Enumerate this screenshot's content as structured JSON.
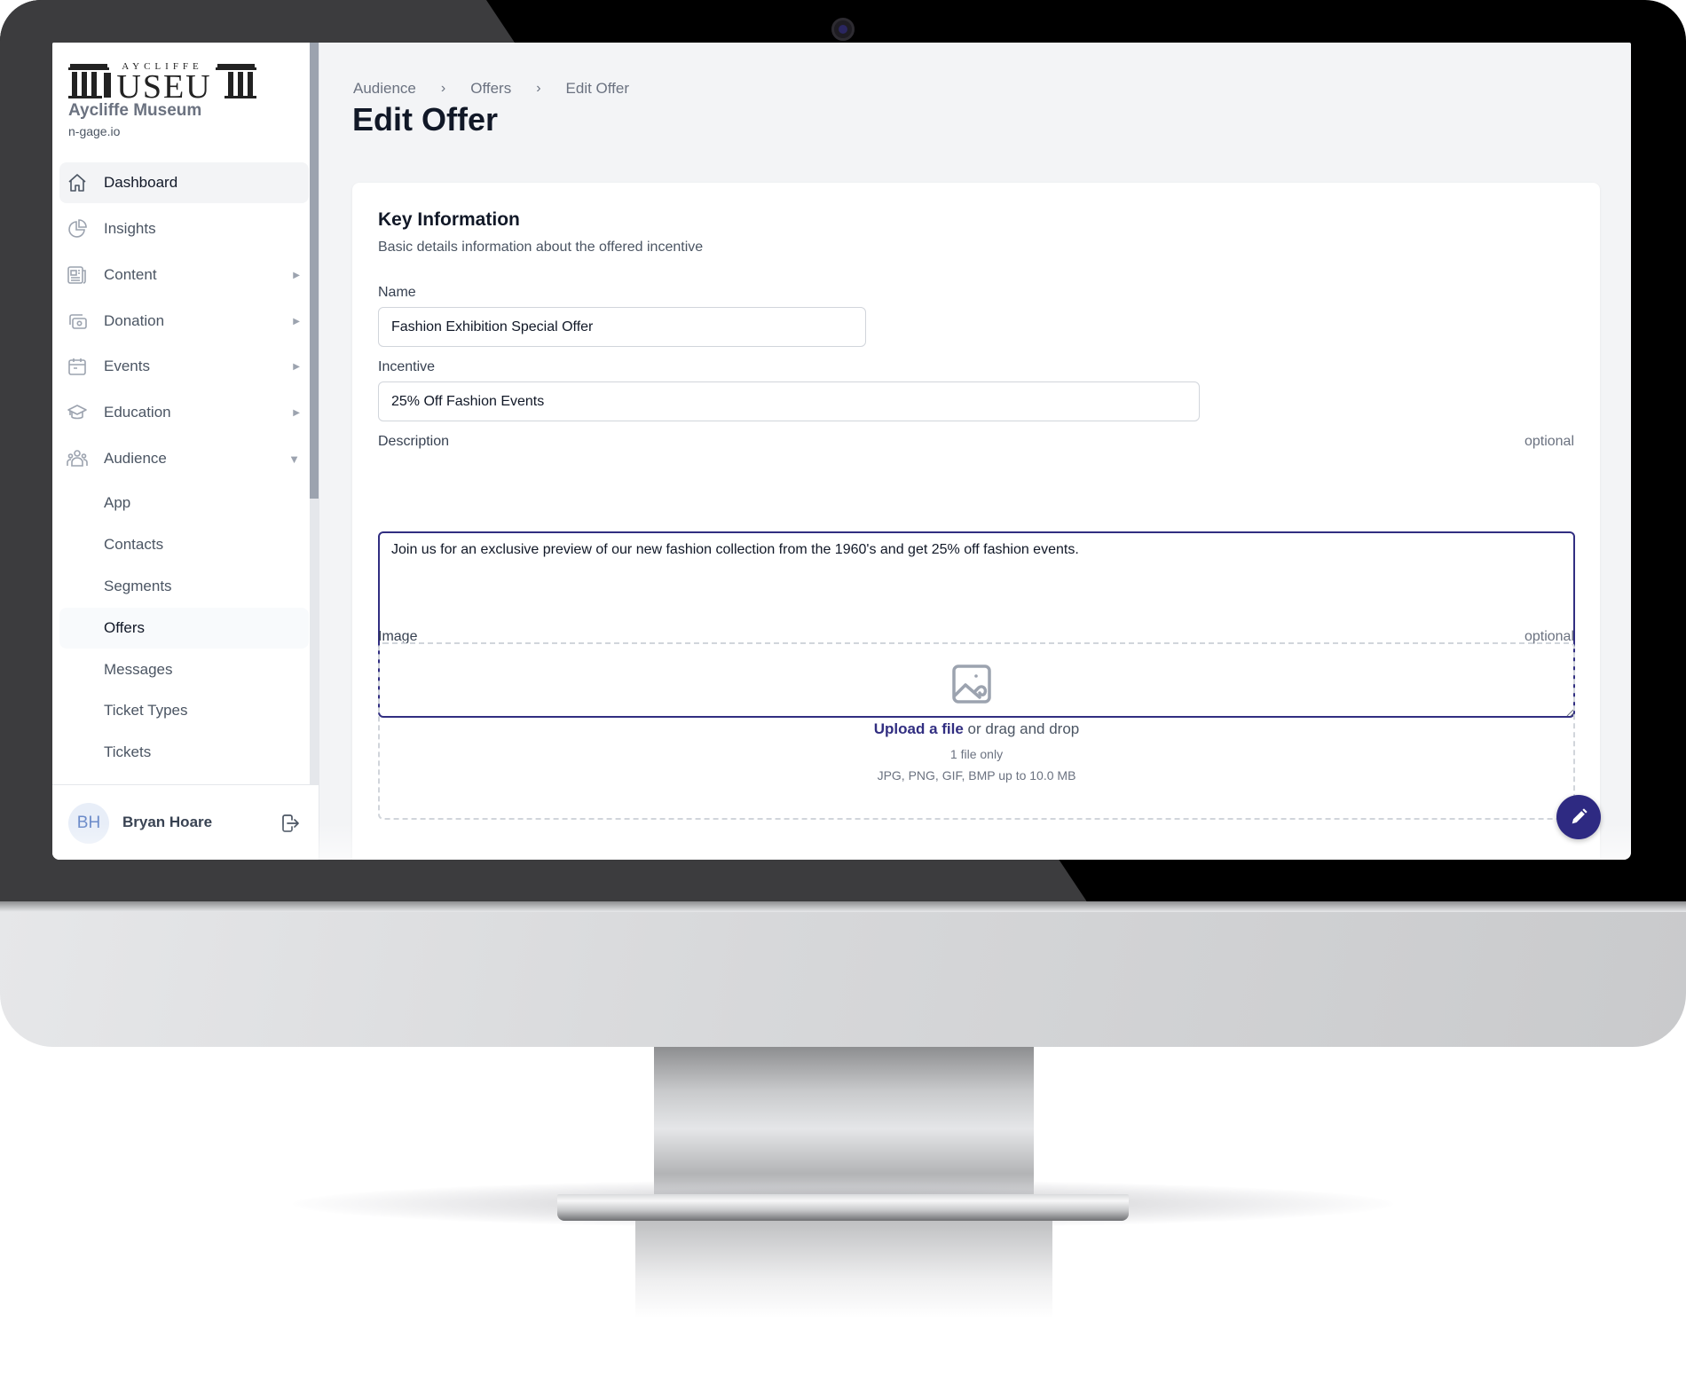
{
  "org": {
    "logo_text_top": "AYCLIFFE",
    "logo_text_main": "MUSEUM",
    "name": "Aycliffe Museum",
    "domain": "n-gage.io"
  },
  "sidebar": {
    "items": [
      {
        "label": "Dashboard",
        "icon": "home-icon",
        "state": "active"
      },
      {
        "label": "Insights",
        "icon": "pie-chart-icon"
      },
      {
        "label": "Content",
        "icon": "newspaper-icon",
        "expandable": true
      },
      {
        "label": "Donation",
        "icon": "cash-icon",
        "expandable": true
      },
      {
        "label": "Events",
        "icon": "calendar-icon",
        "expandable": true
      },
      {
        "label": "Education",
        "icon": "academic-cap-icon",
        "expandable": true
      },
      {
        "label": "Audience",
        "icon": "user-group-icon",
        "expandable": true,
        "expanded": true
      }
    ],
    "audience_children": [
      {
        "label": "App"
      },
      {
        "label": "Contacts"
      },
      {
        "label": "Segments"
      },
      {
        "label": "Offers",
        "state": "current"
      },
      {
        "label": "Messages"
      },
      {
        "label": "Ticket Types"
      },
      {
        "label": "Tickets"
      }
    ],
    "collapsed_arrow": "▶",
    "expanded_arrow": "▼",
    "user": {
      "initials": "BH",
      "name": "Bryan Hoare"
    }
  },
  "breadcrumb": {
    "items": [
      "Audience",
      "Offers",
      "Edit Offer"
    ],
    "separator": "›"
  },
  "page": {
    "title": "Edit Offer"
  },
  "form": {
    "section_title": "Key Information",
    "section_subtitle": "Basic details information about the offered incentive",
    "optional_label": "optional",
    "name": {
      "label": "Name",
      "value": "Fashion Exhibition Special Offer"
    },
    "incentive": {
      "label": "Incentive",
      "value": "25% Off Fashion Events"
    },
    "description": {
      "label": "Description",
      "optional": "optional",
      "value": "Join us for an exclusive preview of our new fashion collection from the 1960's and get 25% off fashion events."
    },
    "image": {
      "label": "Image",
      "optional": "optional",
      "upload_link": "Upload a file",
      "upload_rest": " or drag and drop",
      "limit": "1 file only",
      "types": "JPG, PNG, GIF, BMP up to 10.0 MB"
    }
  },
  "colors": {
    "accent": "#312e81",
    "fab": "#2e2a82",
    "active_bg": "#f3f4f6",
    "page_bg": "#f3f4f6"
  }
}
